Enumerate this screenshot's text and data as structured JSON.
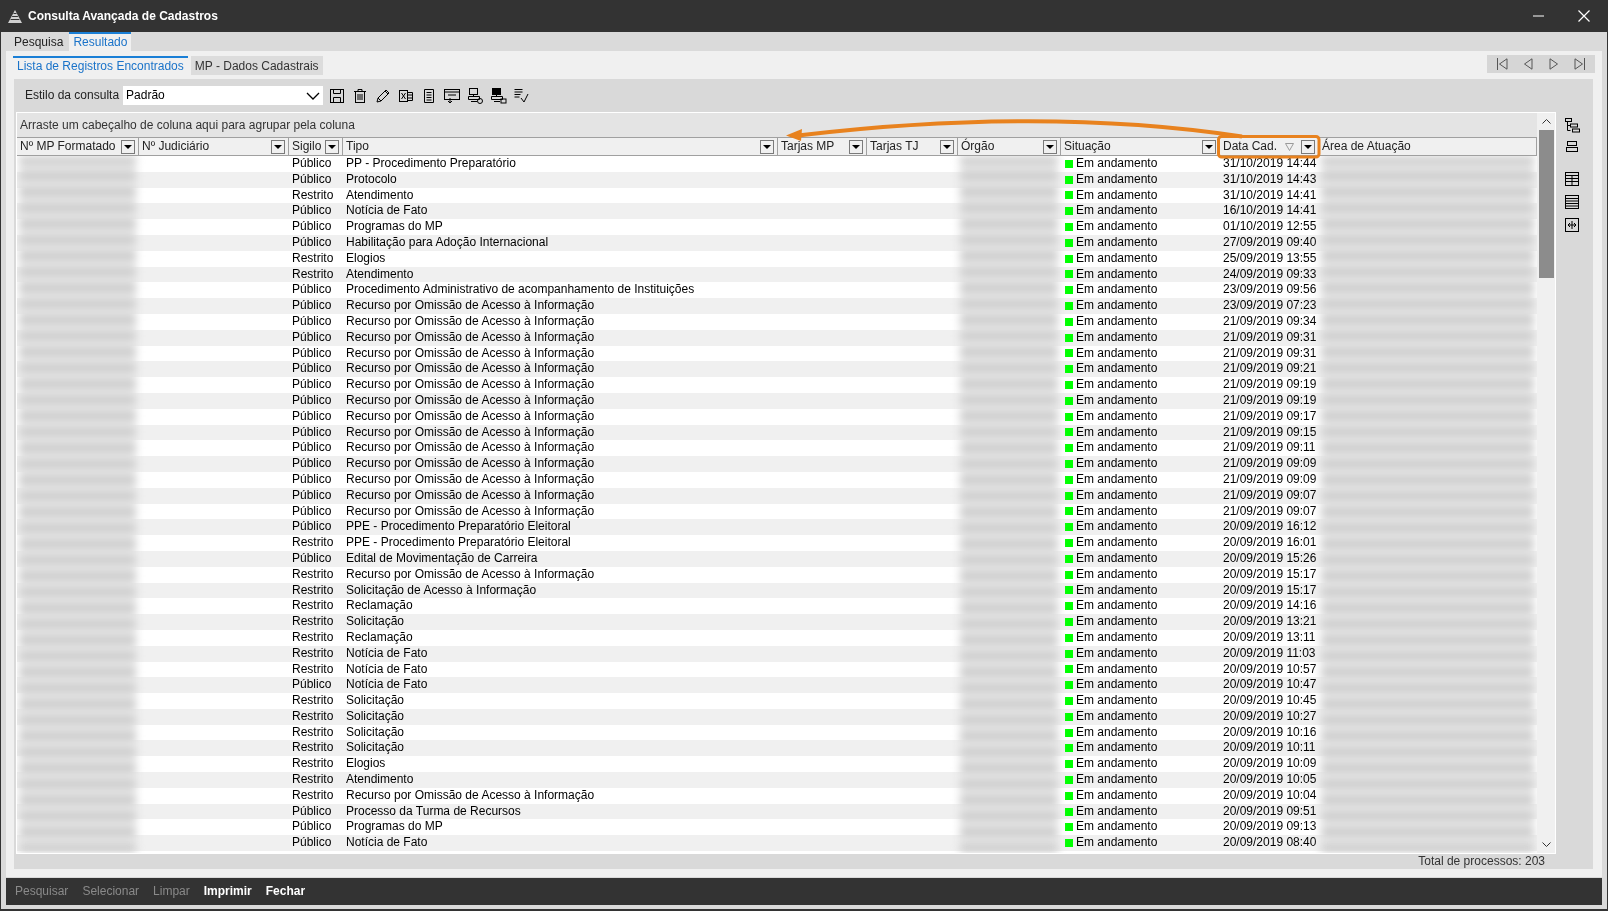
{
  "window": {
    "title": "Consulta Avançada de Cadastros"
  },
  "tabs": [
    {
      "label": "Pesquisa",
      "selected": false
    },
    {
      "label": "Resultado",
      "selected": true
    }
  ],
  "subtabs": [
    {
      "label": "Lista de Registros Encontrados",
      "selected": true
    },
    {
      "label": "MP - Dados Cadastrais",
      "selected": false
    }
  ],
  "toolbar": {
    "style_label": "Estilo da consulta",
    "style_value": "Padrão"
  },
  "grid": {
    "group_hint": "Arraste um cabeçalho de coluna aqui para agrupar pela coluna",
    "columns": [
      {
        "label": "Nº MP Formatado",
        "filter_button": true,
        "redacted": true,
        "highlighted": false,
        "sorted": false
      },
      {
        "label": "Nº Judiciário",
        "filter_button": true,
        "redacted": false,
        "highlighted": false,
        "sorted": false
      },
      {
        "label": "Sigilo",
        "filter_button": true,
        "redacted": false,
        "highlighted": false,
        "sorted": false
      },
      {
        "label": "Tipo",
        "filter_button": true,
        "redacted": false,
        "highlighted": false,
        "sorted": false
      },
      {
        "label": "Tarjas MP",
        "filter_button": true,
        "redacted": false,
        "highlighted": false,
        "sorted": false
      },
      {
        "label": "Tarjas TJ",
        "filter_button": true,
        "redacted": false,
        "highlighted": false,
        "sorted": false
      },
      {
        "label": "Órgão",
        "filter_button": true,
        "redacted": true,
        "highlighted": false,
        "sorted": false
      },
      {
        "label": "Situação",
        "filter_button": true,
        "redacted": false,
        "highlighted": false,
        "sorted": false
      },
      {
        "label": "Data Cad.",
        "filter_button": true,
        "redacted": false,
        "highlighted": true,
        "sorted": true
      },
      {
        "label": "Área de Atuação",
        "filter_button": false,
        "redacted": true,
        "highlighted": false,
        "sorted": false
      }
    ],
    "annotation": {
      "kind": "arrow"
    },
    "rows": [
      {
        "sigilo": "Público",
        "tipo": "PP - Procedimento Preparatório",
        "situacao": "Em andamento",
        "color": "#00ff00",
        "data_cad": "31/10/2019 14:44"
      },
      {
        "sigilo": "Público",
        "tipo": "Protocolo",
        "situacao": "Em andamento",
        "color": "#00ff00",
        "data_cad": "31/10/2019 14:43"
      },
      {
        "sigilo": "Restrito",
        "tipo": "Atendimento",
        "situacao": "Em andamento",
        "color": "#00ff00",
        "data_cad": "31/10/2019 14:41"
      },
      {
        "sigilo": "Público",
        "tipo": "Notícia de Fato",
        "situacao": "Em andamento",
        "color": "#00ff00",
        "data_cad": "16/10/2019 14:41"
      },
      {
        "sigilo": "Público",
        "tipo": "Programas do MP",
        "situacao": "Em andamento",
        "color": "#00ff00",
        "data_cad": "01/10/2019 12:55"
      },
      {
        "sigilo": "Público",
        "tipo": "Habilitação para Adoção Internacional",
        "situacao": "Em andamento",
        "color": "#00ff00",
        "data_cad": "27/09/2019 09:40"
      },
      {
        "sigilo": "Restrito",
        "tipo": "Elogios",
        "situacao": "Em andamento",
        "color": "#00ff00",
        "data_cad": "25/09/2019 13:55"
      },
      {
        "sigilo": "Restrito",
        "tipo": "Atendimento",
        "situacao": "Em andamento",
        "color": "#00ff00",
        "data_cad": "24/09/2019 09:33"
      },
      {
        "sigilo": "Público",
        "tipo": "Procedimento Administrativo de acompanhamento de Instituições",
        "situacao": "Em andamento",
        "color": "#00ff00",
        "data_cad": "23/09/2019 09:56"
      },
      {
        "sigilo": "Público",
        "tipo": "Recurso por Omissão de Acesso à Informação",
        "situacao": "Em andamento",
        "color": "#00ff00",
        "data_cad": "23/09/2019 07:23"
      },
      {
        "sigilo": "Público",
        "tipo": "Recurso por Omissão de Acesso à Informação",
        "situacao": "Em andamento",
        "color": "#00ff00",
        "data_cad": "21/09/2019 09:34"
      },
      {
        "sigilo": "Público",
        "tipo": "Recurso por Omissão de Acesso à Informação",
        "situacao": "Em andamento",
        "color": "#00ff00",
        "data_cad": "21/09/2019 09:31"
      },
      {
        "sigilo": "Público",
        "tipo": "Recurso por Omissão de Acesso à Informação",
        "situacao": "Em andamento",
        "color": "#00ff00",
        "data_cad": "21/09/2019 09:31"
      },
      {
        "sigilo": "Público",
        "tipo": "Recurso por Omissão de Acesso à Informação",
        "situacao": "Em andamento",
        "color": "#00ff00",
        "data_cad": "21/09/2019 09:21"
      },
      {
        "sigilo": "Público",
        "tipo": "Recurso por Omissão de Acesso à Informação",
        "situacao": "Em andamento",
        "color": "#00ff00",
        "data_cad": "21/09/2019 09:19"
      },
      {
        "sigilo": "Público",
        "tipo": "Recurso por Omissão de Acesso à Informação",
        "situacao": "Em andamento",
        "color": "#00ff00",
        "data_cad": "21/09/2019 09:19"
      },
      {
        "sigilo": "Público",
        "tipo": "Recurso por Omissão de Acesso à Informação",
        "situacao": "Em andamento",
        "color": "#00ff00",
        "data_cad": "21/09/2019 09:17"
      },
      {
        "sigilo": "Público",
        "tipo": "Recurso por Omissão de Acesso à Informação",
        "situacao": "Em andamento",
        "color": "#00ff00",
        "data_cad": "21/09/2019 09:15"
      },
      {
        "sigilo": "Público",
        "tipo": "Recurso por Omissão de Acesso à Informação",
        "situacao": "Em andamento",
        "color": "#00ff00",
        "data_cad": "21/09/2019 09:11"
      },
      {
        "sigilo": "Público",
        "tipo": "Recurso por Omissão de Acesso à Informação",
        "situacao": "Em andamento",
        "color": "#00ff00",
        "data_cad": "21/09/2019 09:09"
      },
      {
        "sigilo": "Público",
        "tipo": "Recurso por Omissão de Acesso à Informação",
        "situacao": "Em andamento",
        "color": "#00ff00",
        "data_cad": "21/09/2019 09:09"
      },
      {
        "sigilo": "Público",
        "tipo": "Recurso por Omissão de Acesso à Informação",
        "situacao": "Em andamento",
        "color": "#00ff00",
        "data_cad": "21/09/2019 09:07"
      },
      {
        "sigilo": "Público",
        "tipo": "Recurso por Omissão de Acesso à Informação",
        "situacao": "Em andamento",
        "color": "#00ff00",
        "data_cad": "21/09/2019 09:07"
      },
      {
        "sigilo": "Público",
        "tipo": "PPE - Procedimento Preparatório Eleitoral",
        "situacao": "Em andamento",
        "color": "#00ff00",
        "data_cad": "20/09/2019 16:12"
      },
      {
        "sigilo": "Restrito",
        "tipo": "PPE - Procedimento Preparatório Eleitoral",
        "situacao": "Em andamento",
        "color": "#00ff00",
        "data_cad": "20/09/2019 16:01"
      },
      {
        "sigilo": "Público",
        "tipo": "Edital de Movimentação de Carreira",
        "situacao": "Em andamento",
        "color": "#00ff00",
        "data_cad": "20/09/2019 15:26"
      },
      {
        "sigilo": "Restrito",
        "tipo": "Recurso por Omissão de Acesso à Informação",
        "situacao": "Em andamento",
        "color": "#00ff00",
        "data_cad": "20/09/2019 15:17"
      },
      {
        "sigilo": "Restrito",
        "tipo": "Solicitação de Acesso à Informação",
        "situacao": "Em andamento",
        "color": "#00ff00",
        "data_cad": "20/09/2019 15:17"
      },
      {
        "sigilo": "Restrito",
        "tipo": "Reclamação",
        "situacao": "Em andamento",
        "color": "#00ff00",
        "data_cad": "20/09/2019 14:16"
      },
      {
        "sigilo": "Restrito",
        "tipo": "Solicitação",
        "situacao": "Em andamento",
        "color": "#00ff00",
        "data_cad": "20/09/2019 13:21"
      },
      {
        "sigilo": "Restrito",
        "tipo": "Reclamação",
        "situacao": "Em andamento",
        "color": "#00ff00",
        "data_cad": "20/09/2019 13:11"
      },
      {
        "sigilo": "Restrito",
        "tipo": "Notícia de Fato",
        "situacao": "Em andamento",
        "color": "#00ff00",
        "data_cad": "20/09/2019 11:03"
      },
      {
        "sigilo": "Restrito",
        "tipo": "Notícia de Fato",
        "situacao": "Em andamento",
        "color": "#00ff00",
        "data_cad": "20/09/2019 10:57"
      },
      {
        "sigilo": "Público",
        "tipo": "Notícia de Fato",
        "situacao": "Em andamento",
        "color": "#00ff00",
        "data_cad": "20/09/2019 10:47"
      },
      {
        "sigilo": "Restrito",
        "tipo": "Solicitação",
        "situacao": "Em andamento",
        "color": "#00ff00",
        "data_cad": "20/09/2019 10:45"
      },
      {
        "sigilo": "Restrito",
        "tipo": "Solicitação",
        "situacao": "Em andamento",
        "color": "#00ff00",
        "data_cad": "20/09/2019 10:27"
      },
      {
        "sigilo": "Restrito",
        "tipo": "Solicitação",
        "situacao": "Em andamento",
        "color": "#00ff00",
        "data_cad": "20/09/2019 10:16"
      },
      {
        "sigilo": "Restrito",
        "tipo": "Solicitação",
        "situacao": "Em andamento",
        "color": "#00ff00",
        "data_cad": "20/09/2019 10:11"
      },
      {
        "sigilo": "Restrito",
        "tipo": "Elogios",
        "situacao": "Em andamento",
        "color": "#00ff00",
        "data_cad": "20/09/2019 10:09"
      },
      {
        "sigilo": "Restrito",
        "tipo": "Atendimento",
        "situacao": "Em andamento",
        "color": "#00ff00",
        "data_cad": "20/09/2019 10:05"
      },
      {
        "sigilo": "Restrito",
        "tipo": "Recurso por Omissão de Acesso à Informação",
        "situacao": "Em andamento",
        "color": "#00ff00",
        "data_cad": "20/09/2019 10:04"
      },
      {
        "sigilo": "Público",
        "tipo": "Processo da Turma de Recursos",
        "situacao": "Em andamento",
        "color": "#00ff00",
        "data_cad": "20/09/2019 09:51"
      },
      {
        "sigilo": "Público",
        "tipo": "Programas do MP",
        "situacao": "Em andamento",
        "color": "#00ff00",
        "data_cad": "20/09/2019 09:13"
      },
      {
        "sigilo": "Público",
        "tipo": "Notícia de Fato",
        "situacao": "Em andamento",
        "color": "#00ff00",
        "data_cad": "20/09/2019 08:40"
      }
    ]
  },
  "total": "Total de processos: 203",
  "buttons": [
    {
      "label": "Pesquisar",
      "disabled": true
    },
    {
      "label": "Selecionar",
      "disabled": true
    },
    {
      "label": "Limpar",
      "disabled": true
    },
    {
      "label": "Imprimir",
      "disabled": false
    },
    {
      "label": "Fechar",
      "disabled": false
    }
  ]
}
